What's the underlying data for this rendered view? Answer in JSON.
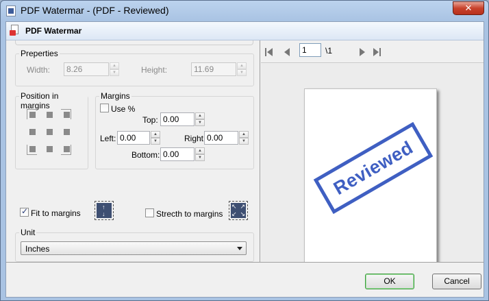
{
  "window": {
    "title": "PDF Watermar - (PDF - Reviewed)",
    "close_label": "✕"
  },
  "header": {
    "title": "PDF Watermar"
  },
  "properties": {
    "legend": "Preperties",
    "width_label": "Width:",
    "width_value": "8.26",
    "height_label": "Height:",
    "height_value": "11.69"
  },
  "position": {
    "legend": "Position in margins"
  },
  "margins": {
    "legend": "Margins",
    "use_percent_label": "Use %",
    "top_label": "Top:",
    "top_value": "0.00",
    "left_label": "Left:",
    "left_value": "0.00",
    "right_label": "Right:",
    "right_value": "0.00",
    "bottom_label": "Bottom:",
    "bottom_value": "0.00"
  },
  "fit": {
    "fit_label": "Fit to margins",
    "fit_checked": true,
    "stretch_label": "Strecth to margins",
    "stretch_checked": false
  },
  "unit": {
    "legend": "Unit",
    "selected": "Inches"
  },
  "preview": {
    "page_number": "1",
    "page_total": "\\1",
    "stamp_text": "Reviewed",
    "stamp_color": "#3f5fc2"
  },
  "footer": {
    "ok_label": "OK",
    "cancel_label": "Cancel"
  }
}
